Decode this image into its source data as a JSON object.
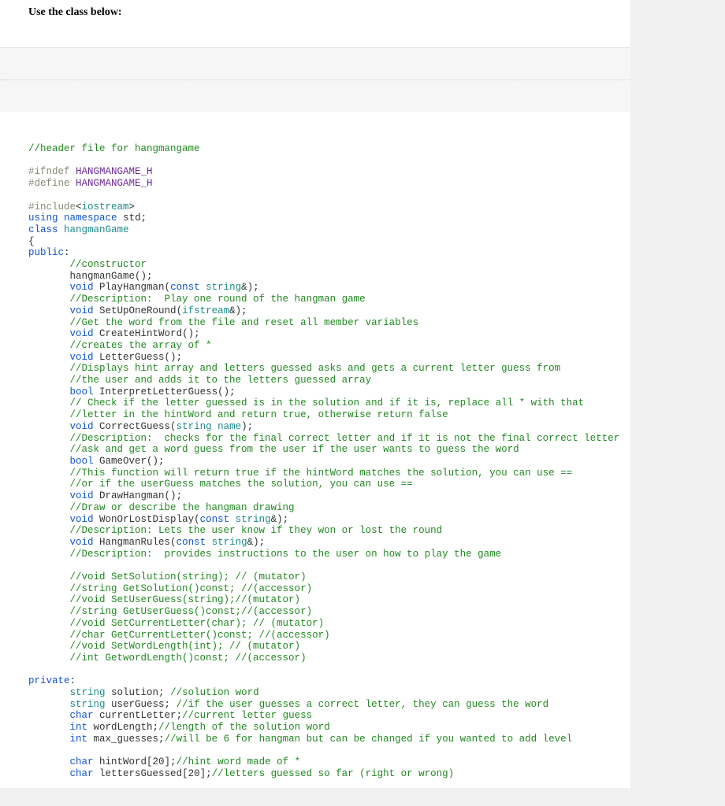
{
  "prompt": {
    "text": "Use the class  below:"
  },
  "code": {
    "header_comment": "//header file for hangmangame",
    "pp_ifndef": "#ifndef",
    "pp_define": "#define",
    "guard": "HANGMANGAME_H",
    "pp_include": "#include",
    "inc_lt": "<",
    "inc_name": "iostream",
    "inc_gt": ">",
    "kw_using": "using",
    "kw_namespace": "namespace",
    "ns_std": "std",
    "kw_class": "class",
    "cls": "hangmanGame",
    "brace_open": "{",
    "kw_public": "public",
    "colon": ":",
    "cmt_ctor": "//constructor",
    "ctor": "hangmanGame();",
    "kw_void": "void",
    "kw_bool": "bool",
    "kw_const": "const",
    "t_string": "string",
    "t_ifstream": "ifstream",
    "amp_close": "&);",
    "fn_play": "PlayHangman(",
    "fn_setup": "SetUpOneRound(",
    "fn_createhint": "CreateHintWord();",
    "fn_letterguess": "LetterGuess();",
    "fn_interpret": "InterpretLetterGuess();",
    "fn_correct": "CorrectGuess(",
    "p_name": "name",
    "paren_close_semi": ");",
    "fn_gameover": "GameOver();",
    "fn_draw": "DrawHangman();",
    "fn_wonlost": "WonOrLostDisplay(",
    "fn_rules": "HangmanRules(",
    "cmt_play": "//Description:  Play one round of the hangman game",
    "cmt_setup": "//Get the word from the file and reset all member variables",
    "cmt_createhint": "//creates the array of *",
    "cmt_letterguess1": "//Displays hint array and letters guessed asks and gets a current letter guess from",
    "cmt_letterguess2": "//the user and adds it to the letters guessed array",
    "cmt_interp1": "// Check if the letter guessed is in the solution and if it is, replace all * with that",
    "cmt_interp2": "//letter in the hintWord and return true, otherwise return false",
    "cmt_correct1": "//Description:  checks for the final correct letter and if it is not the final correct letter",
    "cmt_correct2": "//ask and get a word guess from the user if the user wants to guess the word",
    "cmt_gameover1": "//This function will return true if the hintWord matches the solution, you can use ==",
    "cmt_gameover2": "//or if the userGuess matches the solution, you can use ==",
    "cmt_draw": "//Draw or describe the hangman drawing",
    "cmt_wonlost": "//Description: Lets the user know if they won or lost the round",
    "cmt_rules": "//Description:  provides instructions to the user on how to play the game",
    "cmt_mut1": "//void SetSolution(string); // (mutator)",
    "cmt_mut2": "//string GetSolution()const; //(accessor)",
    "cmt_mut3": "//void SetUserGuess(string);//(mutator)",
    "cmt_mut4": "//string GetUserGuess()const;//(accessor)",
    "cmt_mut5": "//void SetCurrentLetter(char); // (mutator)",
    "cmt_mut6": "//char GetCurrentLetter()const; //(accessor)",
    "cmt_mut7": "//void SetWordLength(int); // (mutator)",
    "cmt_mut8": "//int GetwordLength()const; //(accessor)",
    "kw_private": "private",
    "t_char": "char",
    "t_int": "int",
    "m_solution": "solution;",
    "m_userguess": "userGuess;",
    "m_curletter": "currentLetter;",
    "m_wordlen": "wordLength;",
    "m_maxguess": "max_guesses;",
    "m_hintword": "hintWord[20];",
    "m_lettersg": "lettersGuessed[20];",
    "cmt_m_sol": "//solution word",
    "cmt_m_ug": "//if the user guesses a correct letter, they can guess the word",
    "cmt_m_cl": "//current letter guess",
    "cmt_m_wl": "//length of the solution word",
    "cmt_m_mg": "//will be 6 for hangman but can be changed if you wanted to add level",
    "cmt_m_hw": "//hint word made of *",
    "cmt_m_lg": "//letters guessed so far (right or wrong)",
    "semi": ";"
  }
}
